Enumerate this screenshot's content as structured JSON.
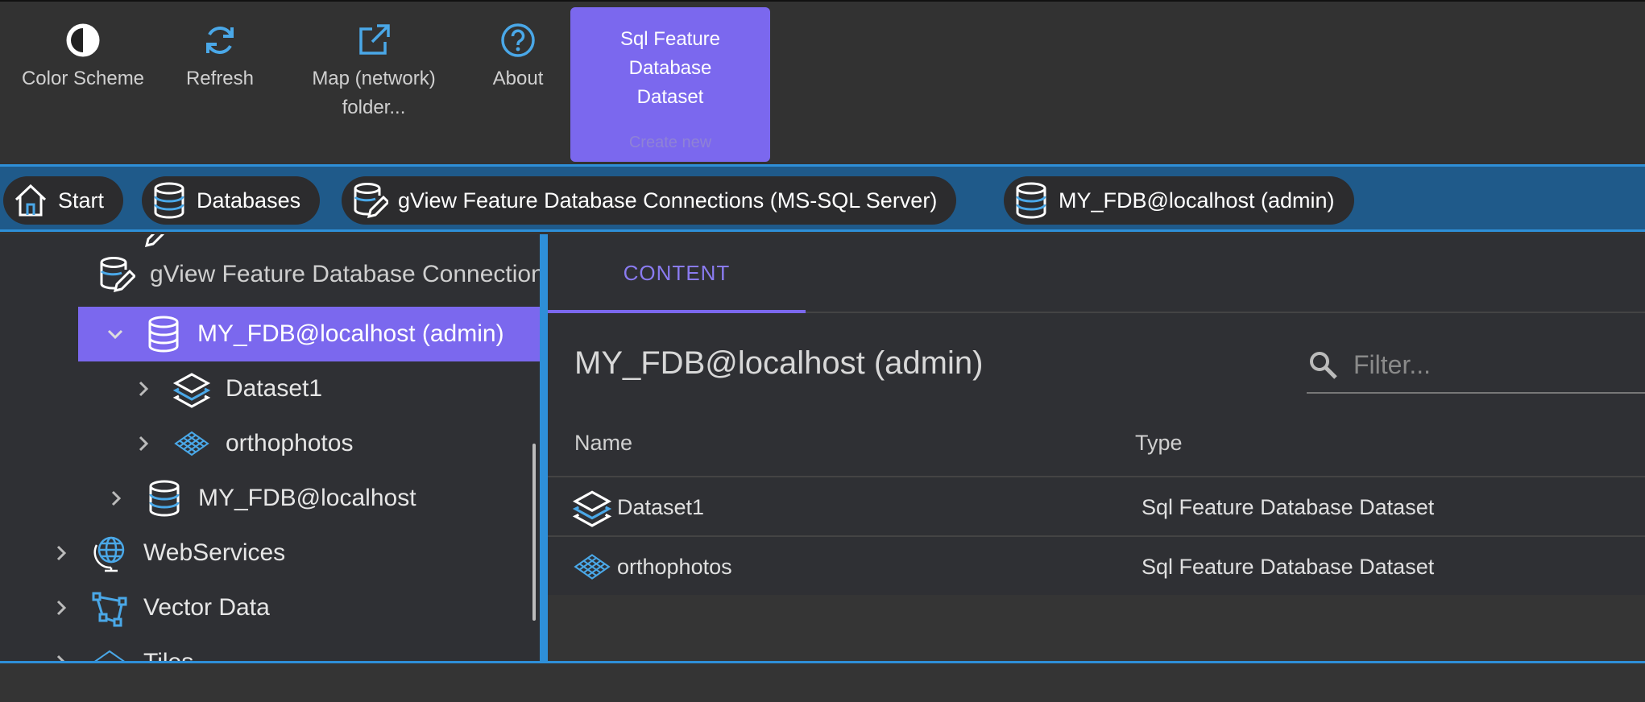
{
  "toolbar": {
    "color_scheme": "Color Scheme",
    "refresh": "Refresh",
    "map_folder_line1": "Map (network)",
    "map_folder_line2": "folder...",
    "about": "About",
    "create_line1": "Sql Feature",
    "create_line2": "Database",
    "create_line3": "Dataset",
    "create_sub": "Create new"
  },
  "breadcrumb": [
    {
      "label": "Start",
      "icon": "home-icon"
    },
    {
      "label": "Databases",
      "icon": "database-icon"
    },
    {
      "label": "gView Feature Database Connections (MS-SQL Server)",
      "icon": "database-edit-icon"
    },
    {
      "label": "MY_FDB@localhost (admin)",
      "icon": "database-icon"
    }
  ],
  "tree": {
    "items": [
      {
        "label": "gView Feature Database Connections (MS-SQL Server)",
        "expanded": true
      },
      {
        "label": "MY_FDB@localhost (admin)",
        "expanded": true,
        "selected": true
      },
      {
        "label": "Dataset1",
        "expanded": false
      },
      {
        "label": "orthophotos",
        "expanded": false
      },
      {
        "label": "MY_FDB@localhost",
        "expanded": false
      },
      {
        "label": "WebServices",
        "expanded": false
      },
      {
        "label": "Vector Data",
        "expanded": false
      },
      {
        "label": "Tiles",
        "expanded": false
      }
    ]
  },
  "content": {
    "tab": "CONTENT",
    "title": "MY_FDB@localhost (admin)",
    "filter_placeholder": "Filter...",
    "columns": [
      "Name",
      "Type"
    ],
    "rows": [
      {
        "name": "Dataset1",
        "type": "Sql Feature Database Dataset",
        "icon": "layers-icon"
      },
      {
        "name": "orthophotos",
        "type": "Sql Feature Database Dataset",
        "icon": "raster-grid-icon"
      }
    ]
  },
  "colors": {
    "accent": "#7b68ee",
    "blue": "#2e8fd8",
    "icon_blue": "#4aa8e8",
    "bg": "#343434"
  }
}
